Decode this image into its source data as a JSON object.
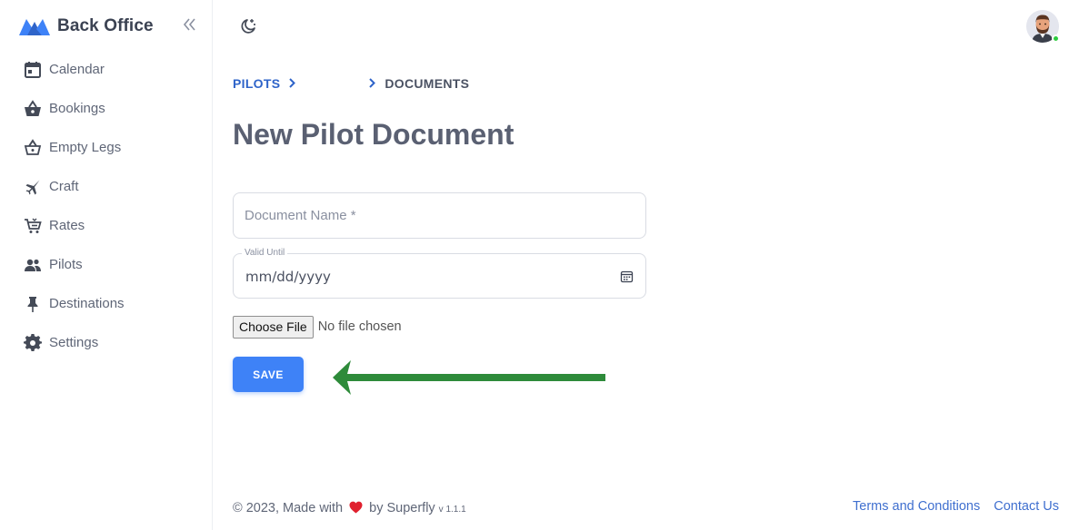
{
  "app": {
    "title": "Back Office",
    "brand_color": "#3e82f7"
  },
  "sidebar": {
    "collapse_icon": "double-chevron-left-icon",
    "items": [
      {
        "label": "Calendar",
        "icon": "calendar-icon"
      },
      {
        "label": "Bookings",
        "icon": "basket-icon"
      },
      {
        "label": "Empty Legs",
        "icon": "basket-outline-icon"
      },
      {
        "label": "Craft",
        "icon": "airplane-icon"
      },
      {
        "label": "Rates",
        "icon": "cart-icon"
      },
      {
        "label": "Pilots",
        "icon": "people-icon"
      },
      {
        "label": "Destinations",
        "icon": "pin-icon"
      },
      {
        "label": "Settings",
        "icon": "gear-icon"
      }
    ]
  },
  "header": {
    "theme_icon": "moon-star-icon",
    "avatar_status_color": "#2ecc40"
  },
  "breadcrumb": {
    "parent": "PILOTS",
    "current": "DOCUMENTS"
  },
  "page": {
    "title": "New Pilot Document"
  },
  "form": {
    "document_name_placeholder": "Document Name *",
    "document_name_value": "",
    "valid_until_label": "Valid Until",
    "valid_until_value": "mm/dd/yyyy",
    "file_button": "Choose File",
    "file_status": "No file chosen",
    "save_label": "SAVE"
  },
  "annotation": {
    "arrow_color": "#2e8b3a",
    "arrow_target": "save-button"
  },
  "footer": {
    "copyright_prefix": "© 2023, Made with",
    "copyright_suffix": "by Superfly",
    "version": "v 1.1.1",
    "terms_label": "Terms and Conditions",
    "contact_label": "Contact Us",
    "heart_color": "#e0202e"
  }
}
